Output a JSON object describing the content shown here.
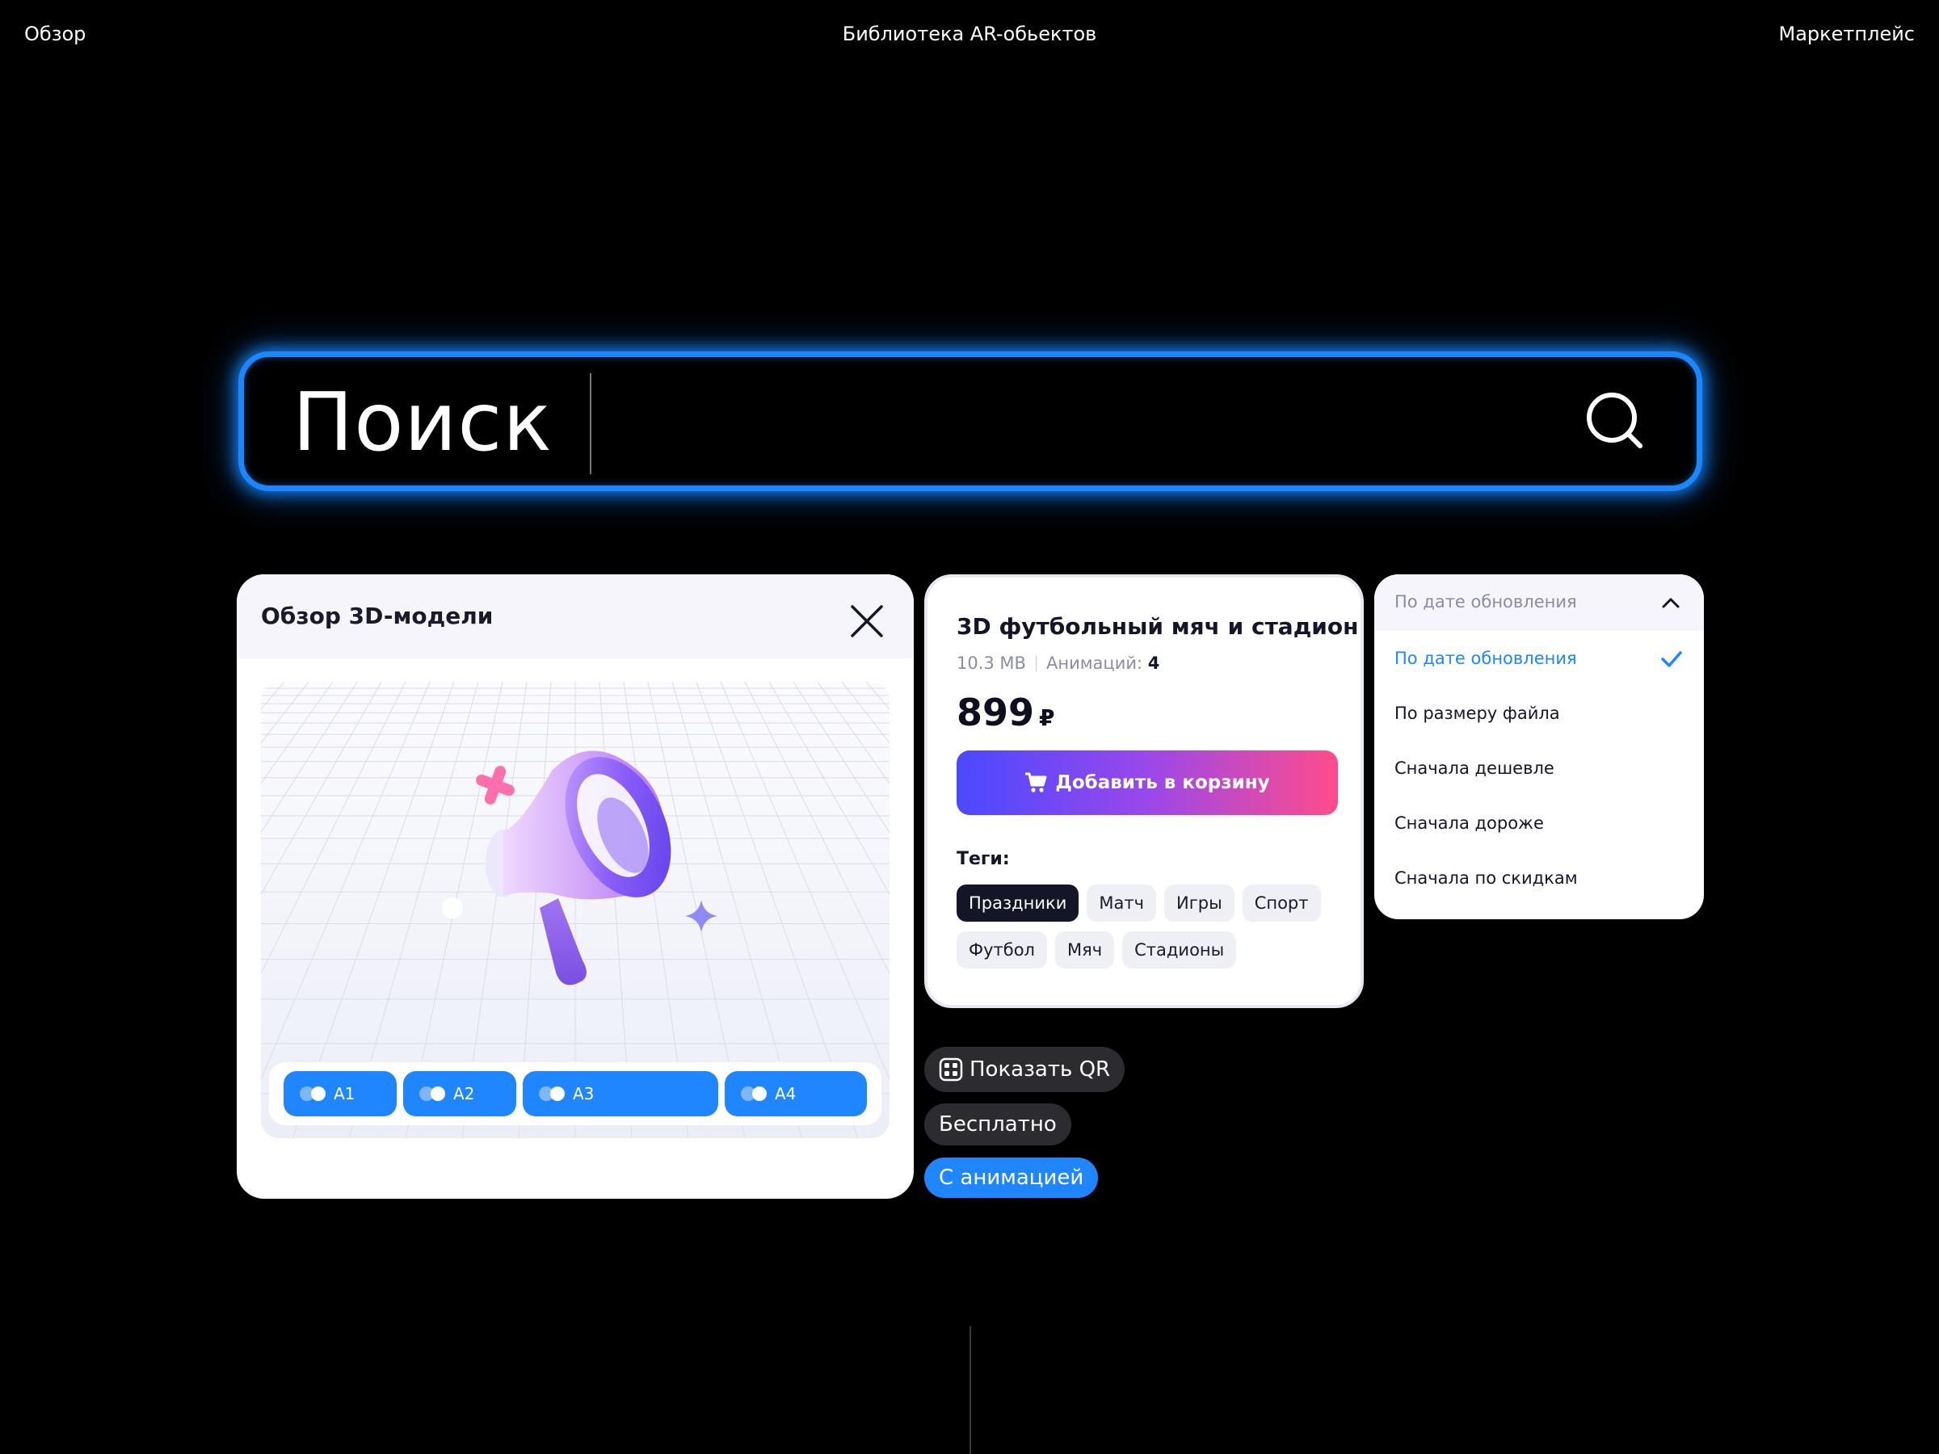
{
  "nav": {
    "left": "Обзор",
    "center": "Библиотека AR-обьектов",
    "right": "Маркетплейс"
  },
  "search": {
    "text": "Поиск",
    "icon": "search-icon",
    "glow_color": "#1a86ff"
  },
  "preview": {
    "title": "Обзор 3D-модели",
    "close_icon": "close-icon",
    "animations": [
      "A1",
      "A2",
      "A3",
      "A4"
    ]
  },
  "product": {
    "title": "3D футбольный мяч и стадион",
    "size": "10.3 MB",
    "animations_label": "Анимаций:",
    "animations_count": "4",
    "price": "899",
    "currency": "₽",
    "cart_label": "Добавить в корзину",
    "tags_label": "Теги:",
    "tags": [
      "Праздники",
      "Матч",
      "Игры",
      "Спорт",
      "Футбол",
      "Мяч",
      "Стадионы"
    ],
    "active_tag": "Праздники"
  },
  "sort": {
    "current": "По дате обновления",
    "options": [
      "По дате обновления",
      "По размеру файла",
      "Сначала дешевле",
      "Сначала дороже",
      "Сначала по скидкам"
    ],
    "selected": "По дате обновления",
    "accent": "#1f86ff"
  },
  "chips": {
    "qr": "Показать QR",
    "free": "Бесплатно",
    "animated": "С анимацией"
  }
}
